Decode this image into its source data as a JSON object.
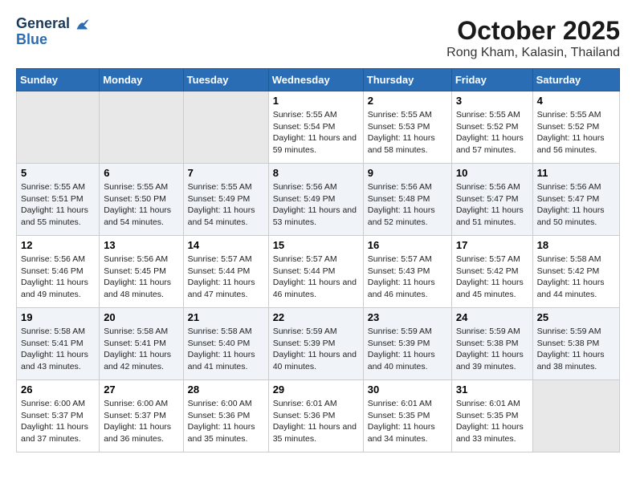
{
  "logo": {
    "line1": "General",
    "line2": "Blue"
  },
  "title": "October 2025",
  "subtitle": "Rong Kham, Kalasin, Thailand",
  "days_of_week": [
    "Sunday",
    "Monday",
    "Tuesday",
    "Wednesday",
    "Thursday",
    "Friday",
    "Saturday"
  ],
  "weeks": [
    [
      {
        "day": "",
        "empty": true
      },
      {
        "day": "",
        "empty": true
      },
      {
        "day": "",
        "empty": true
      },
      {
        "day": "1",
        "sunrise": "5:55 AM",
        "sunset": "5:54 PM",
        "daylight": "11 hours and 59 minutes."
      },
      {
        "day": "2",
        "sunrise": "5:55 AM",
        "sunset": "5:53 PM",
        "daylight": "11 hours and 58 minutes."
      },
      {
        "day": "3",
        "sunrise": "5:55 AM",
        "sunset": "5:52 PM",
        "daylight": "11 hours and 57 minutes."
      },
      {
        "day": "4",
        "sunrise": "5:55 AM",
        "sunset": "5:52 PM",
        "daylight": "11 hours and 56 minutes."
      }
    ],
    [
      {
        "day": "5",
        "sunrise": "5:55 AM",
        "sunset": "5:51 PM",
        "daylight": "11 hours and 55 minutes."
      },
      {
        "day": "6",
        "sunrise": "5:55 AM",
        "sunset": "5:50 PM",
        "daylight": "11 hours and 54 minutes."
      },
      {
        "day": "7",
        "sunrise": "5:55 AM",
        "sunset": "5:49 PM",
        "daylight": "11 hours and 54 minutes."
      },
      {
        "day": "8",
        "sunrise": "5:56 AM",
        "sunset": "5:49 PM",
        "daylight": "11 hours and 53 minutes."
      },
      {
        "day": "9",
        "sunrise": "5:56 AM",
        "sunset": "5:48 PM",
        "daylight": "11 hours and 52 minutes."
      },
      {
        "day": "10",
        "sunrise": "5:56 AM",
        "sunset": "5:47 PM",
        "daylight": "11 hours and 51 minutes."
      },
      {
        "day": "11",
        "sunrise": "5:56 AM",
        "sunset": "5:47 PM",
        "daylight": "11 hours and 50 minutes."
      }
    ],
    [
      {
        "day": "12",
        "sunrise": "5:56 AM",
        "sunset": "5:46 PM",
        "daylight": "11 hours and 49 minutes."
      },
      {
        "day": "13",
        "sunrise": "5:56 AM",
        "sunset": "5:45 PM",
        "daylight": "11 hours and 48 minutes."
      },
      {
        "day": "14",
        "sunrise": "5:57 AM",
        "sunset": "5:44 PM",
        "daylight": "11 hours and 47 minutes."
      },
      {
        "day": "15",
        "sunrise": "5:57 AM",
        "sunset": "5:44 PM",
        "daylight": "11 hours and 46 minutes."
      },
      {
        "day": "16",
        "sunrise": "5:57 AM",
        "sunset": "5:43 PM",
        "daylight": "11 hours and 46 minutes."
      },
      {
        "day": "17",
        "sunrise": "5:57 AM",
        "sunset": "5:42 PM",
        "daylight": "11 hours and 45 minutes."
      },
      {
        "day": "18",
        "sunrise": "5:58 AM",
        "sunset": "5:42 PM",
        "daylight": "11 hours and 44 minutes."
      }
    ],
    [
      {
        "day": "19",
        "sunrise": "5:58 AM",
        "sunset": "5:41 PM",
        "daylight": "11 hours and 43 minutes."
      },
      {
        "day": "20",
        "sunrise": "5:58 AM",
        "sunset": "5:41 PM",
        "daylight": "11 hours and 42 minutes."
      },
      {
        "day": "21",
        "sunrise": "5:58 AM",
        "sunset": "5:40 PM",
        "daylight": "11 hours and 41 minutes."
      },
      {
        "day": "22",
        "sunrise": "5:59 AM",
        "sunset": "5:39 PM",
        "daylight": "11 hours and 40 minutes."
      },
      {
        "day": "23",
        "sunrise": "5:59 AM",
        "sunset": "5:39 PM",
        "daylight": "11 hours and 40 minutes."
      },
      {
        "day": "24",
        "sunrise": "5:59 AM",
        "sunset": "5:38 PM",
        "daylight": "11 hours and 39 minutes."
      },
      {
        "day": "25",
        "sunrise": "5:59 AM",
        "sunset": "5:38 PM",
        "daylight": "11 hours and 38 minutes."
      }
    ],
    [
      {
        "day": "26",
        "sunrise": "6:00 AM",
        "sunset": "5:37 PM",
        "daylight": "11 hours and 37 minutes."
      },
      {
        "day": "27",
        "sunrise": "6:00 AM",
        "sunset": "5:37 PM",
        "daylight": "11 hours and 36 minutes."
      },
      {
        "day": "28",
        "sunrise": "6:00 AM",
        "sunset": "5:36 PM",
        "daylight": "11 hours and 35 minutes."
      },
      {
        "day": "29",
        "sunrise": "6:01 AM",
        "sunset": "5:36 PM",
        "daylight": "11 hours and 35 minutes."
      },
      {
        "day": "30",
        "sunrise": "6:01 AM",
        "sunset": "5:35 PM",
        "daylight": "11 hours and 34 minutes."
      },
      {
        "day": "31",
        "sunrise": "6:01 AM",
        "sunset": "5:35 PM",
        "daylight": "11 hours and 33 minutes."
      },
      {
        "day": "",
        "empty": true
      }
    ]
  ]
}
